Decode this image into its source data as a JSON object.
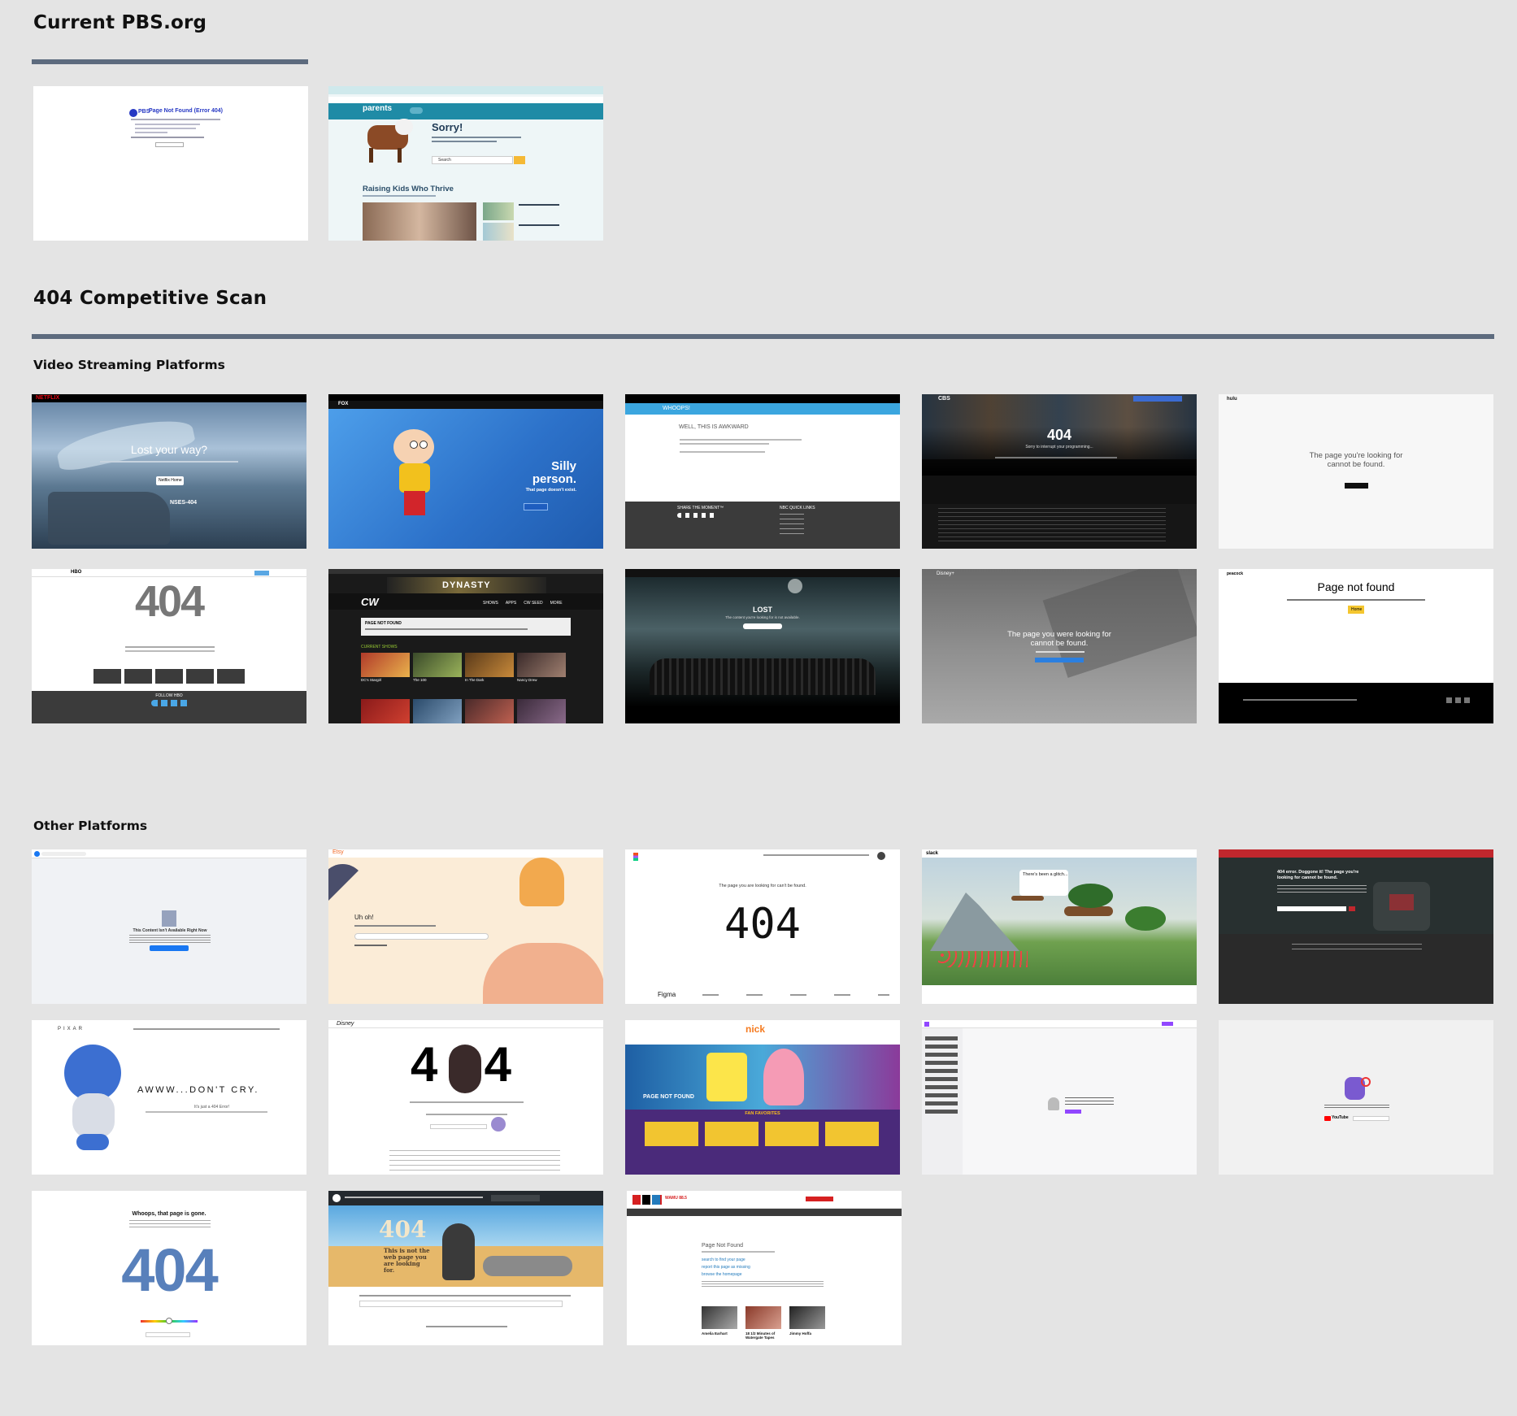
{
  "sections": {
    "current": {
      "title": "Current PBS.org"
    },
    "scan": {
      "title": "404 Competitive Scan"
    },
    "video": {
      "title": "Video Streaming Platforms"
    },
    "other": {
      "title": "Other Platforms"
    }
  },
  "thumbs": {
    "pbs": {
      "logo": "PBS",
      "title": "Page Not Found (Error 404)"
    },
    "parents": {
      "logo": "parents",
      "sorry": "Sorry!",
      "search": "Search",
      "heading": "Raising Kids Who Thrive"
    },
    "netflix": {
      "logo": "NETFLIX",
      "title": "Lost your way?",
      "button": "Netflix Home",
      "code": "NSES-404"
    },
    "fox": {
      "logo": "FOX",
      "line1": "Silly",
      "line2": "person.",
      "sub": "That page doesn't exist."
    },
    "nbc": {
      "bar": "WHOOPS!",
      "title": "WELL, THIS IS AWKWARD",
      "share": "SHARE THE MOMENT™",
      "links": "NBC QUICK LINKS"
    },
    "cbs": {
      "logo": "CBS",
      "code": "404",
      "sub": "Sorry to interrupt your programming..."
    },
    "hulu": {
      "logo": "hulu",
      "msg": "The page you're looking for cannot be found."
    },
    "hbo": {
      "logo": "HBO",
      "code": "404",
      "follow": "FOLLOW HBO"
    },
    "cw": {
      "show": "DYNASTY",
      "logo": "CW",
      "nav": [
        "SHOWS",
        "APPS",
        "CW SEED",
        "MORE"
      ],
      "notfound": "PAGE NOT FOUND",
      "current": "CURRENT SHOWS",
      "shows": [
        "DC's Stargirl",
        "The 100",
        "In The Dark",
        "Nancy Drew"
      ]
    },
    "abc": {
      "title": "LOST",
      "sub": "The content you're looking for is not available."
    },
    "disney": {
      "logo": "Disney+",
      "msg": "The page you were looking for cannot be found."
    },
    "peacock": {
      "logo": "peacock",
      "title": "Page not found",
      "button": "Home"
    },
    "etsy": {
      "logo": "Etsy",
      "title": "Uh oh!"
    },
    "figma": {
      "title": "The page you are looking for can't be found.",
      "code": "404",
      "logo": "Figma"
    },
    "slack": {
      "logo": "slack",
      "msg": "There's been a glitch..."
    },
    "nyt": {
      "title": "404 error. Doggone it! The page you're looking for cannot be found."
    },
    "pixar": {
      "logo": "PIXAR",
      "title": "AWWW...DON'T CRY.",
      "sub": "It's just a 404 Error!"
    },
    "disneycom": {
      "code": "404"
    },
    "nick": {
      "logo": "nick",
      "title": "PAGE NOT FOUND",
      "fav": "FAN FAVORITES"
    },
    "twitch": {},
    "youtube": {
      "logo": "YouTube"
    },
    "dribbble": {
      "title": "Whoops, that page is gone.",
      "code": "404"
    },
    "github": {
      "code": "404",
      "msg": "This is not the web page you are looking for."
    },
    "npr": {
      "logo": "npr",
      "title": "Page Not Found",
      "links": [
        "search to find your page",
        "report this page as missing",
        "browse the homepage"
      ],
      "stories": [
        "Amelia Earhart",
        "18 1/2 Minutes of Watergate Tapes",
        "Jimmy Hoffa"
      ]
    }
  }
}
